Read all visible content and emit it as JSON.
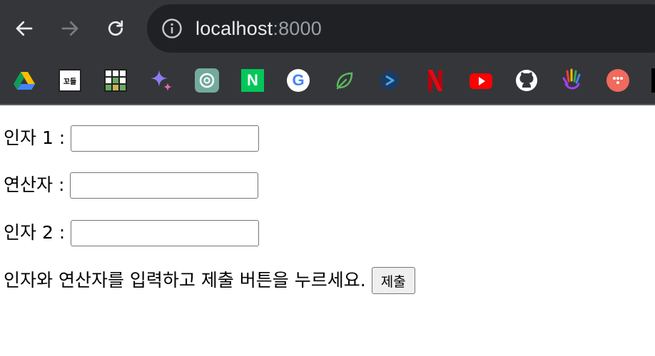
{
  "browser": {
    "url_host": "localhost",
    "url_port": ":8000",
    "bookmarks": [
      {
        "icon": "google-drive-icon",
        "label": ""
      },
      {
        "icon": "kkodeul-icon",
        "label": "꼬들"
      },
      {
        "icon": "grid-game-icon",
        "label": ""
      },
      {
        "icon": "gemini-icon",
        "label": ""
      },
      {
        "icon": "chatgpt-icon",
        "label": ""
      },
      {
        "icon": "naver-icon",
        "label": "N"
      },
      {
        "icon": "google-icon",
        "label": "G"
      },
      {
        "icon": "leaf-icon",
        "label": ""
      },
      {
        "icon": "hexagon-arrow-icon",
        "label": ""
      },
      {
        "icon": "netflix-icon",
        "label": ""
      },
      {
        "icon": "youtube-icon",
        "label": ""
      },
      {
        "icon": "github-icon",
        "label": ""
      },
      {
        "icon": "colorful-hand-icon",
        "label": ""
      },
      {
        "icon": "more-dots-icon",
        "label": ""
      }
    ]
  },
  "form": {
    "arg1_label": "인자 1 :",
    "operator_label": "연산자 :",
    "arg2_label": "인자 2 :",
    "arg1_value": "",
    "operator_value": "",
    "arg2_value": "",
    "instruction": "인자와 연산자를 입력하고 제출 버튼을 누르세요.",
    "submit_label": "제출"
  },
  "colors": {
    "chrome_bg": "#35363a",
    "omnibox_bg": "#202124"
  }
}
